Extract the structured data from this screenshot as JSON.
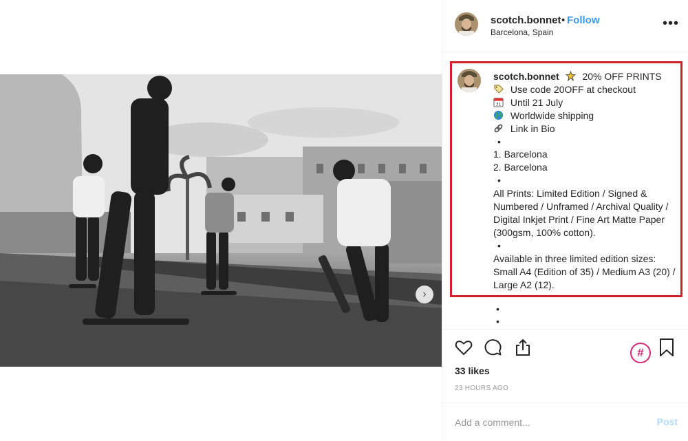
{
  "post": {
    "image_alt": "Black and white photo of skateboarders in a plaza",
    "username": "scotch.bonnet",
    "separator": "•",
    "follow_label": "Follow",
    "location": "Barcelona, Spain",
    "more_icon": "more-options-icon",
    "more_glyph": "•••",
    "next_glyph": "›"
  },
  "caption": {
    "username": "scotch.bonnet",
    "lines": [
      {
        "emoji": "sparkle-pin-icon",
        "text": "20% OFF PRINTS"
      },
      {
        "emoji": "label-tag-icon",
        "text": "Use code 20OFF at checkout"
      },
      {
        "emoji": "calendar-icon",
        "text": "Until 21 July"
      },
      {
        "emoji": "globe-icon",
        "text": "Worldwide shipping"
      },
      {
        "emoji": "link-icon",
        "text": "Link in Bio"
      }
    ],
    "dot": "•",
    "list": [
      "1. Barcelona",
      "2. Barcelona"
    ],
    "prints_text": "All Prints: Limited Edition / Signed & Numbered / Unframed / Archival Quality / Digital Inkjet Print / Fine Art Matte Paper (300gsm, 100% cotton).",
    "sizes_text": "Available in three limited edition sizes: Small A4 (Edition of 35) / Medium A3 (20) / Large A2 (12).",
    "highlight_color": "#d31f26"
  },
  "actions": {
    "like_icon": "heart-icon",
    "comment_icon": "comment-icon",
    "share_icon": "share-icon",
    "hashtag_icon": "hashtag-icon",
    "hashtag_glyph": "#",
    "save_icon": "bookmark-icon",
    "likes": "33 likes",
    "timestamp": "23 HOURS AGO"
  },
  "comment": {
    "placeholder": "Add a comment...",
    "post_label": "Post"
  },
  "colors": {
    "link_blue": "#3897f0",
    "post_disabled": "#b3dbff",
    "hashtag_pink": "#d62976"
  }
}
